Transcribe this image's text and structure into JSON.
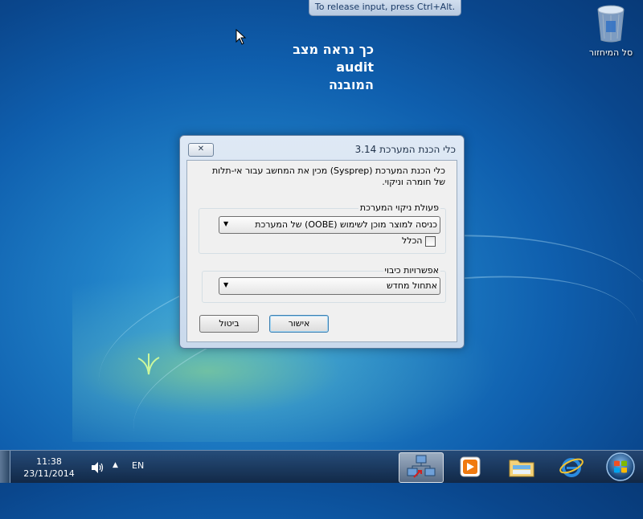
{
  "notification": {
    "text": "To release input, press Ctrl+Alt."
  },
  "desktop_text": {
    "lines": [
      "כך נראה מצב",
      "audit",
      "המובנה"
    ]
  },
  "desktop_icons": [
    {
      "label": "סל המיחזור",
      "icon": "recycle-bin-icon"
    }
  ],
  "dialog": {
    "title": "כלי הכנת המערכת 3.14",
    "close_label": "✕",
    "description": "כלי הכנת המערכת (Sysprep) מכין את המחשב עבור אי-תלות של חומרה וניקוי.",
    "cleanup_group": {
      "label": "פעולת ניקוי המערכת",
      "selected": "כניסה למוצר מוכן לשימוש (OOBE) של המערכת",
      "generalize_label": "הכלל",
      "generalize_checked": false
    },
    "shutdown_group": {
      "label": "אפשרויות כיבוי",
      "selected": "אתחול מחדש"
    },
    "ok_label": "אישור",
    "cancel_label": "ביטול"
  },
  "taskbar": {
    "time": "11:38",
    "date": "23/11/2014",
    "language": "EN",
    "pinned": [
      {
        "name": "network-sysprep-icon",
        "active": true
      },
      {
        "name": "media-player-icon",
        "active": false
      },
      {
        "name": "file-explorer-icon",
        "active": false
      },
      {
        "name": "internet-explorer-icon",
        "active": false
      }
    ]
  },
  "colors": {
    "desktop_blue": "#1f7fc6",
    "dialog_frame": "#c9d9ec",
    "taskbar": "#1a3556"
  }
}
